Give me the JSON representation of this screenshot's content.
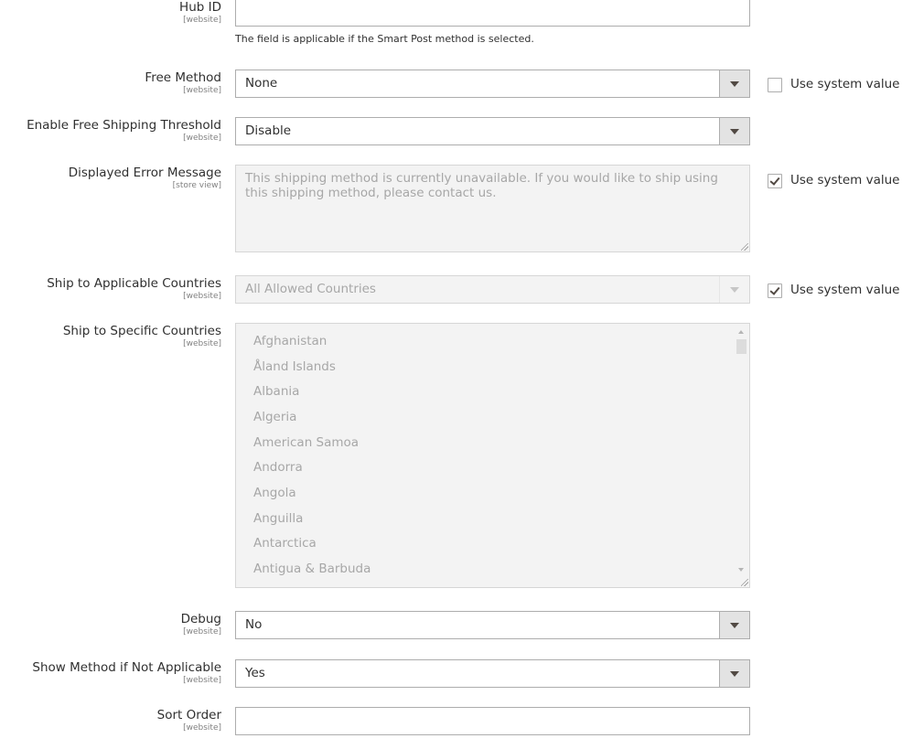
{
  "hub_id": {
    "label": "Hub ID",
    "scope": "[website]",
    "value": "",
    "note": "The field is applicable if the Smart Post method is selected."
  },
  "free_method": {
    "label": "Free Method",
    "scope": "[website]",
    "value": "None",
    "use_system_label": "Use system value",
    "use_system_checked": false
  },
  "free_threshold": {
    "label": "Enable Free Shipping Threshold",
    "scope": "[website]",
    "value": "Disable"
  },
  "error_message": {
    "label": "Displayed Error Message",
    "scope": "[store view]",
    "value": "This shipping method is currently unavailable. If you would like to ship using this shipping method, please contact us.",
    "use_system_label": "Use system value",
    "use_system_checked": true
  },
  "applicable_countries": {
    "label": "Ship to Applicable Countries",
    "scope": "[website]",
    "value": "All Allowed Countries",
    "use_system_label": "Use system value",
    "use_system_checked": true
  },
  "specific_countries": {
    "label": "Ship to Specific Countries",
    "scope": "[website]",
    "options": [
      "Afghanistan",
      "Åland Islands",
      "Albania",
      "Algeria",
      "American Samoa",
      "Andorra",
      "Angola",
      "Anguilla",
      "Antarctica",
      "Antigua & Barbuda"
    ]
  },
  "debug": {
    "label": "Debug",
    "scope": "[website]",
    "value": "No"
  },
  "show_method": {
    "label": "Show Method if Not Applicable",
    "scope": "[website]",
    "value": "Yes"
  },
  "sort_order": {
    "label": "Sort Order",
    "scope": "[website]",
    "value": ""
  }
}
